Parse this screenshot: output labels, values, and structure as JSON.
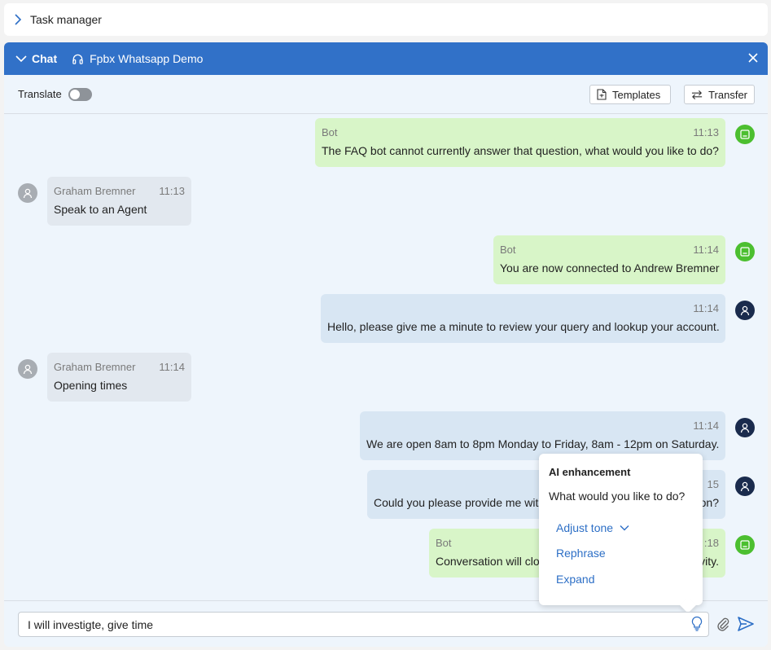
{
  "task_manager": {
    "title": "Task manager"
  },
  "chat_header": {
    "label": "Chat",
    "channel": "Fpbx Whatsapp Demo"
  },
  "toolbar": {
    "translate_label": "Translate",
    "templates_label": "Templates",
    "transfer_label": "Transfer"
  },
  "messages": [
    {
      "sender": "Bot",
      "time": "11:13",
      "text": "The FAQ bot cannot currently answer that question, what would you like to do?"
    },
    {
      "sender": "Graham Bremner",
      "time": "11:13",
      "text": "Speak to an Agent"
    },
    {
      "sender": "Bot",
      "time": "11:14",
      "text": "You are now connected to Andrew Bremner"
    },
    {
      "sender": "",
      "time": "11:14",
      "text": "Hello, please give me a minute to review your query and lookup your account."
    },
    {
      "sender": "Graham Bremner",
      "time": "11:14",
      "text": "Opening times"
    },
    {
      "sender": "",
      "time": "11:14",
      "text": "We are open 8am to 8pm Monday to Friday, 8am - 12pm on Saturday."
    },
    {
      "sender": "",
      "time": "15",
      "text": "Could you please provide me wit"
    },
    {
      "sender": "Bot",
      "time": ":18",
      "text": "Conversation will clo"
    }
  ],
  "partial_tails": {
    "msg7": "on?",
    "msg8": "vity."
  },
  "ai_popup": {
    "title": "AI enhancement",
    "question": "What would you like to do?",
    "options": {
      "adjust_tone": "Adjust tone",
      "rephrase": "Rephrase",
      "expand": "Expand"
    }
  },
  "composer": {
    "value": "I will investigte, give time"
  },
  "icons": {
    "task_chevron": "chevron-right-icon",
    "header_chevron": "chevron-down-icon",
    "headset": "headset-icon",
    "close": "close-icon",
    "bot": "bot-icon",
    "user": "user-icon",
    "bulb": "lightbulb-icon",
    "attach": "paperclip-icon",
    "send": "send-icon"
  },
  "colors": {
    "header_bg": "#3171c8",
    "bot_bubble": "#d8f5c8",
    "agent_bubble": "#d8e6f3",
    "customer_bubble": "#e2e8ef",
    "bot_avatar": "#4cbf30",
    "agent_avatar": "#1a2b4d",
    "link": "#2d6fc6"
  }
}
